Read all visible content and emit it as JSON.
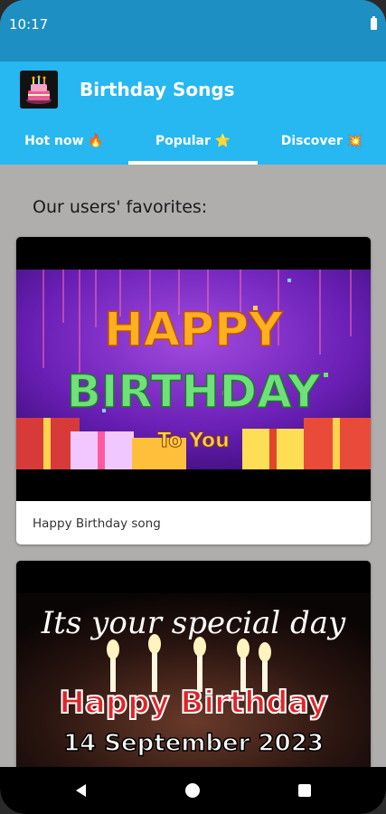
{
  "status_bar": {
    "time": "10:17"
  },
  "app": {
    "title": "Birthday Songs"
  },
  "tabs": [
    {
      "label": "Hot now",
      "emoji": "🔥"
    },
    {
      "label": "Popular",
      "emoji": "⭐"
    },
    {
      "label": "Discover",
      "emoji": "💥"
    }
  ],
  "section": {
    "title": "Our users' favorites:"
  },
  "cards": [
    {
      "thumbnail": {
        "line1": "HAPPY",
        "line2": "BIRTHDAY",
        "line3": "To You"
      },
      "caption": "Happy Birthday song"
    },
    {
      "thumbnail": {
        "line1": "Its your special day",
        "line2": "Happy Birthday",
        "line3": "14 September 2023"
      }
    }
  ],
  "colors": {
    "app_bar": "#27b7f1",
    "status_bar": "#1d8fc2",
    "background": "#b0adad"
  },
  "nav": {
    "back_icon": "back-triangle-icon",
    "home_icon": "home-circle-icon",
    "recent_icon": "recent-square-icon"
  }
}
